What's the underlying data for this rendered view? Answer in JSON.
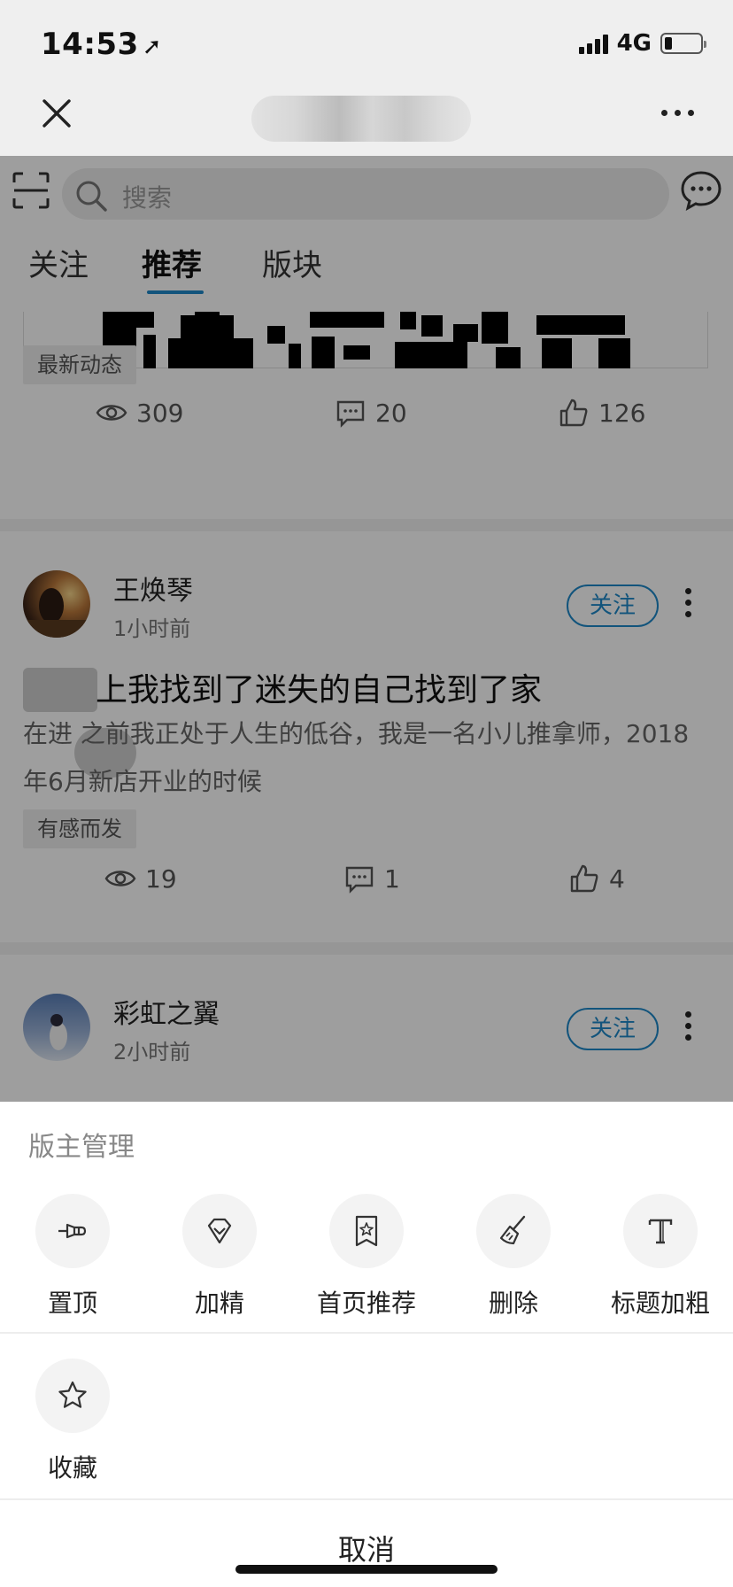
{
  "status_bar": {
    "time": "14:53",
    "network": "4G"
  },
  "feed": {
    "search_placeholder": "搜索",
    "tabs": [
      {
        "label": "关注"
      },
      {
        "label": "推荐",
        "active": true
      },
      {
        "label": "版块"
      }
    ],
    "card1": {
      "tag": "最新动态",
      "views": "309",
      "comments": "20",
      "likes": "126"
    },
    "posts": [
      {
        "author": "王焕琴",
        "time": "1小时前",
        "follow_label": "关注",
        "title": "上我找到了迷失的自己找到了家",
        "excerpt": "在进 之前我正处于人生的低谷，我是一名小儿推拿师，2018年6月新店开业的时候",
        "tag": "有感而发",
        "views": "19",
        "comments": "1",
        "likes": "4"
      },
      {
        "author": "彩虹之翼",
        "time": "2小时前",
        "follow_label": "关注"
      }
    ]
  },
  "sheet": {
    "title": "版主管理",
    "actions": [
      {
        "label": "置顶",
        "icon": "pin-icon"
      },
      {
        "label": "加精",
        "icon": "diamond-icon"
      },
      {
        "label": "首页推荐",
        "icon": "bookmark-star-icon"
      },
      {
        "label": "删除",
        "icon": "broom-icon"
      },
      {
        "label": "标题加粗",
        "icon": "bold-t-icon"
      },
      {
        "label": "收藏",
        "icon": "star-icon"
      }
    ],
    "cancel_label": "取消"
  }
}
